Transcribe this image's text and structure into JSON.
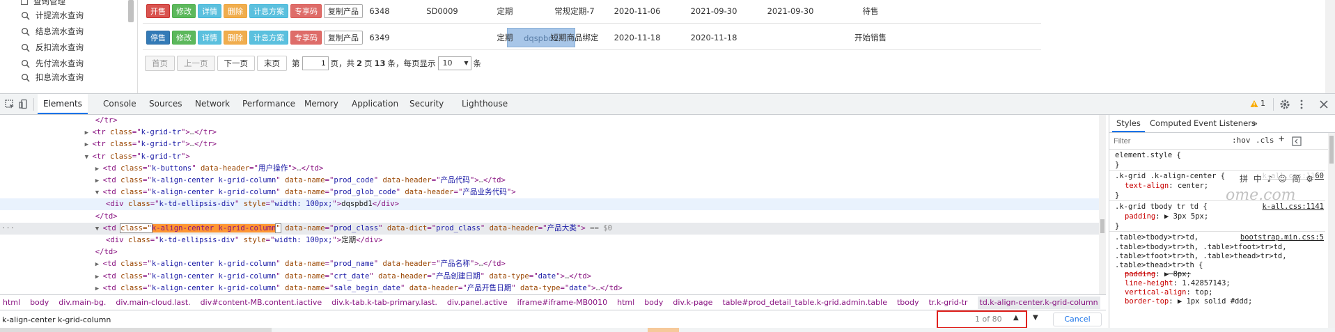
{
  "sidebar": {
    "top_item_partial": "查询管理",
    "items": [
      {
        "label": "计提流水查询"
      },
      {
        "label": "结息流水查询"
      },
      {
        "label": "反扣流水查询"
      },
      {
        "label": "先付流水查询"
      },
      {
        "label": "扣息流水查询"
      }
    ]
  },
  "table": {
    "rows": [
      {
        "buttons": [
          "开售",
          "修改",
          "详情",
          "删除",
          "计息方案",
          "专享码",
          "复制产品"
        ],
        "id": "6348",
        "code": "SD0009",
        "type": "定期",
        "name": "常规定期-7",
        "date1": "2020-11-06",
        "date2": "2021-09-30",
        "date3": "2021-09-30",
        "status": "待售"
      },
      {
        "buttons": [
          "停售",
          "修改",
          "详情",
          "删除",
          "计息方案",
          "专享码",
          "复制产品"
        ],
        "id": "6349",
        "code": "dqspbd1",
        "type": "定期",
        "name": "短期商品绑定",
        "date1": "2020-11-18",
        "date2": "2020-11-18",
        "date3": "",
        "status": "开始销售"
      }
    ]
  },
  "pager": {
    "first": "首页",
    "prev": "上一页",
    "next": "下一页",
    "last": "末页",
    "page_prefix": "第",
    "page_value": "1",
    "page_suffix": "页，共",
    "total_pages": "2",
    "pages_label": "页",
    "total_items": "13",
    "items_label": "条，每页显示",
    "per_page": "10",
    "per_page_suffix": "条"
  },
  "devtools": {
    "tabs": [
      "Elements",
      "Console",
      "Sources",
      "Network",
      "Performance",
      "Memory",
      "Application",
      "Security",
      "Lighthouse"
    ],
    "active_tab": "Elements",
    "warning_count": "1",
    "styles_tabs": [
      "Styles",
      "Computed",
      "Event Listeners",
      "»"
    ],
    "filter_placeholder": "Filter",
    "filter_options": [
      ":hov",
      ".cls",
      "+"
    ],
    "breadcrumbs": [
      "html",
      "body",
      "div.main-bg.",
      "div.main-cloud.last.",
      "div#content-MB.content.iactive",
      "div.k-tab.k-tab-primary.last.",
      "div.panel.active",
      "iframe#iframe-MB0010",
      "html",
      "body",
      "div.k-page",
      "table#prod_detail_table.k-grid.admin.table",
      "tbody",
      "tr.k-grid-tr",
      "td.k-align-center.k-grid-column"
    ],
    "search_value": "k-align-center k-grid-column",
    "match_count": "1 of 80",
    "cancel_label": "Cancel"
  },
  "dom_lines": [
    {
      "indent": 9,
      "tri": "",
      "parts": [
        [
          "tag",
          "</tr>"
        ]
      ]
    },
    {
      "indent": 8,
      "tri": "▶",
      "parts": [
        [
          "tag",
          "<tr "
        ],
        [
          "an",
          "class"
        ],
        [
          "tag",
          "=\""
        ],
        [
          "av",
          "k-grid-tr"
        ],
        [
          "tag",
          "\">"
        ],
        [
          "dim",
          "…"
        ],
        [
          "tag",
          "</tr>"
        ]
      ]
    },
    {
      "indent": 8,
      "tri": "▶",
      "parts": [
        [
          "tag",
          "<tr "
        ],
        [
          "an",
          "class"
        ],
        [
          "tag",
          "=\""
        ],
        [
          "av",
          "k-grid-tr"
        ],
        [
          "tag",
          "\">"
        ],
        [
          "dim",
          "…"
        ],
        [
          "tag",
          "</tr>"
        ]
      ]
    },
    {
      "indent": 8,
      "tri": "▼",
      "parts": [
        [
          "tag",
          "<tr "
        ],
        [
          "an",
          "class"
        ],
        [
          "tag",
          "=\""
        ],
        [
          "av",
          "k-grid-tr"
        ],
        [
          "tag",
          "\">"
        ]
      ]
    },
    {
      "indent": 9,
      "tri": "▶",
      "parts": [
        [
          "tag",
          "<td "
        ],
        [
          "an",
          "class"
        ],
        [
          "tag",
          "=\""
        ],
        [
          "av",
          "k-buttons"
        ],
        [
          "tag",
          "\" "
        ],
        [
          "an",
          "data-header"
        ],
        [
          "tag",
          "=\""
        ],
        [
          "av",
          "用户操作"
        ],
        [
          "tag",
          "\">"
        ],
        [
          "dim",
          "…"
        ],
        [
          "tag",
          "</td>"
        ]
      ]
    },
    {
      "indent": 9,
      "tri": "▶",
      "parts": [
        [
          "tag",
          "<td "
        ],
        [
          "an",
          "class"
        ],
        [
          "tag",
          "=\""
        ],
        [
          "av",
          "k-align-center k-grid-column"
        ],
        [
          "tag",
          "\" "
        ],
        [
          "an",
          "data-name"
        ],
        [
          "tag",
          "=\""
        ],
        [
          "av",
          "prod_code"
        ],
        [
          "tag",
          "\" "
        ],
        [
          "an",
          "data-header"
        ],
        [
          "tag",
          "=\""
        ],
        [
          "av",
          "产品代码"
        ],
        [
          "tag",
          "\">"
        ],
        [
          "dim",
          "…"
        ],
        [
          "tag",
          "</td>"
        ]
      ]
    },
    {
      "indent": 9,
      "tri": "▼",
      "parts": [
        [
          "tag",
          "<td "
        ],
        [
          "an",
          "class"
        ],
        [
          "tag",
          "=\""
        ],
        [
          "av",
          "k-align-center k-grid-column"
        ],
        [
          "tag",
          "\" "
        ],
        [
          "an",
          "data-name"
        ],
        [
          "tag",
          "=\""
        ],
        [
          "av",
          "prod_glob_code"
        ],
        [
          "tag",
          "\" "
        ],
        [
          "an",
          "data-header"
        ],
        [
          "tag",
          "=\""
        ],
        [
          "av",
          "产品业务代码"
        ],
        [
          "tag",
          "\">"
        ]
      ]
    },
    {
      "indent": 10,
      "tri": "",
      "hover": true,
      "parts": [
        [
          "tag",
          "<div "
        ],
        [
          "an",
          "class"
        ],
        [
          "tag",
          "=\""
        ],
        [
          "av",
          "k-td-ellipsis-div"
        ],
        [
          "tag",
          "\" "
        ],
        [
          "an",
          "style"
        ],
        [
          "tag",
          "=\""
        ],
        [
          "av",
          "width: 100px;"
        ],
        [
          "tag",
          "\">"
        ],
        [
          "tx",
          "dqspbd1"
        ],
        [
          "tag",
          "</div>"
        ]
      ]
    },
    {
      "indent": 9,
      "tri": "",
      "parts": [
        [
          "tag",
          "</td>"
        ]
      ]
    },
    {
      "indent": 9,
      "tri": "▼",
      "selected": true,
      "parts": [
        [
          "tag",
          "<td "
        ],
        [
          "boxed",
          "class=\""
        ],
        [
          "match-cur",
          "k-align-center k-grid-column"
        ],
        [
          "boxed",
          "\""
        ],
        [
          "tag",
          " "
        ],
        [
          "an",
          "data-name"
        ],
        [
          "tag",
          "=\""
        ],
        [
          "av",
          "prod_class"
        ],
        [
          "tag",
          "\" "
        ],
        [
          "an",
          "data-dict"
        ],
        [
          "tag",
          "=\""
        ],
        [
          "av",
          "prod_class"
        ],
        [
          "tag",
          "\" "
        ],
        [
          "an",
          "data-header"
        ],
        [
          "tag",
          "=\""
        ],
        [
          "av",
          "产品大类"
        ],
        [
          "tag",
          "\">"
        ],
        [
          "dim",
          " == $0"
        ]
      ]
    },
    {
      "indent": 10,
      "tri": "",
      "parts": [
        [
          "tag",
          "<div "
        ],
        [
          "an",
          "class"
        ],
        [
          "tag",
          "=\""
        ],
        [
          "av",
          "k-td-ellipsis-div"
        ],
        [
          "tag",
          "\" "
        ],
        [
          "an",
          "style"
        ],
        [
          "tag",
          "=\""
        ],
        [
          "av",
          "width: 100px;"
        ],
        [
          "tag",
          "\">"
        ],
        [
          "tx",
          "定期"
        ],
        [
          "tag",
          "</div>"
        ]
      ]
    },
    {
      "indent": 9,
      "tri": "",
      "parts": [
        [
          "tag",
          "</td>"
        ]
      ]
    },
    {
      "indent": 9,
      "tri": "▶",
      "parts": [
        [
          "tag",
          "<td "
        ],
        [
          "an",
          "class"
        ],
        [
          "tag",
          "=\""
        ],
        [
          "av",
          "k-align-center k-grid-column"
        ],
        [
          "tag",
          "\" "
        ],
        [
          "an",
          "data-name"
        ],
        [
          "tag",
          "=\""
        ],
        [
          "av",
          "prod_name"
        ],
        [
          "tag",
          "\" "
        ],
        [
          "an",
          "data-header"
        ],
        [
          "tag",
          "=\""
        ],
        [
          "av",
          "产品名称"
        ],
        [
          "tag",
          "\">"
        ],
        [
          "dim",
          "…"
        ],
        [
          "tag",
          "</td>"
        ]
      ]
    },
    {
      "indent": 9,
      "tri": "▶",
      "parts": [
        [
          "tag",
          "<td "
        ],
        [
          "an",
          "class"
        ],
        [
          "tag",
          "=\""
        ],
        [
          "av",
          "k-align-center k-grid-column"
        ],
        [
          "tag",
          "\" "
        ],
        [
          "an",
          "data-name"
        ],
        [
          "tag",
          "=\""
        ],
        [
          "av",
          "crt_date"
        ],
        [
          "tag",
          "\" "
        ],
        [
          "an",
          "data-header"
        ],
        [
          "tag",
          "=\""
        ],
        [
          "av",
          "产品创建日期"
        ],
        [
          "tag",
          "\" "
        ],
        [
          "an",
          "data-type"
        ],
        [
          "tag",
          "=\""
        ],
        [
          "av",
          "date"
        ],
        [
          "tag",
          "\">"
        ],
        [
          "dim",
          "…"
        ],
        [
          "tag",
          "</td>"
        ]
      ]
    },
    {
      "indent": 9,
      "tri": "▶",
      "parts": [
        [
          "tag",
          "<td "
        ],
        [
          "an",
          "class"
        ],
        [
          "tag",
          "=\""
        ],
        [
          "av",
          "k-align-center k-grid-column"
        ],
        [
          "tag",
          "\" "
        ],
        [
          "an",
          "data-name"
        ],
        [
          "tag",
          "=\""
        ],
        [
          "av",
          "sale_begin_date"
        ],
        [
          "tag",
          "\" "
        ],
        [
          "an",
          "data-header"
        ],
        [
          "tag",
          "=\""
        ],
        [
          "av",
          "产品开售日期"
        ],
        [
          "tag",
          "\" "
        ],
        [
          "an",
          "data-type"
        ],
        [
          "tag",
          "=\""
        ],
        [
          "av",
          "date"
        ],
        [
          "tag",
          "\">"
        ],
        [
          "dim",
          "…"
        ],
        [
          "tag",
          "</td>"
        ]
      ]
    }
  ],
  "styles_rules": [
    {
      "selector": "element.style {",
      "source": "",
      "props": []
    },
    {
      "selector": ".k-grid .k-align-center {",
      "source": "k-all.css:1160",
      "props": [
        [
          "text-align",
          "center;"
        ]
      ]
    },
    {
      "selector": ".k-grid tbody tr td {",
      "source": "k-all.css:1141",
      "props": [
        [
          "padding",
          "▶ 3px 5px;"
        ]
      ]
    },
    {
      "selector": ".table>tbody>tr>td,",
      "source": "bootstrap.min.css:5",
      "props": []
    }
  ],
  "styles_extra_lines": [
    ".table>tbody>tr>th, .table>tfoot>tr>td,",
    ".table>tfoot>tr>th, .table>thead>tr>td,",
    ".table>thead>tr>th {"
  ],
  "styles_tail_props": [
    [
      "padding",
      "▶ 8px;"
    ],
    [
      "line-height",
      "1.42857143;"
    ],
    [
      "vertical-align",
      "top;"
    ],
    [
      "border-top",
      "▶ 1px solid #ddd;"
    ]
  ],
  "overlay": {
    "ime": "拼 中 ♪ ☺ 简 ⚙",
    "watermark": "ome.com"
  }
}
